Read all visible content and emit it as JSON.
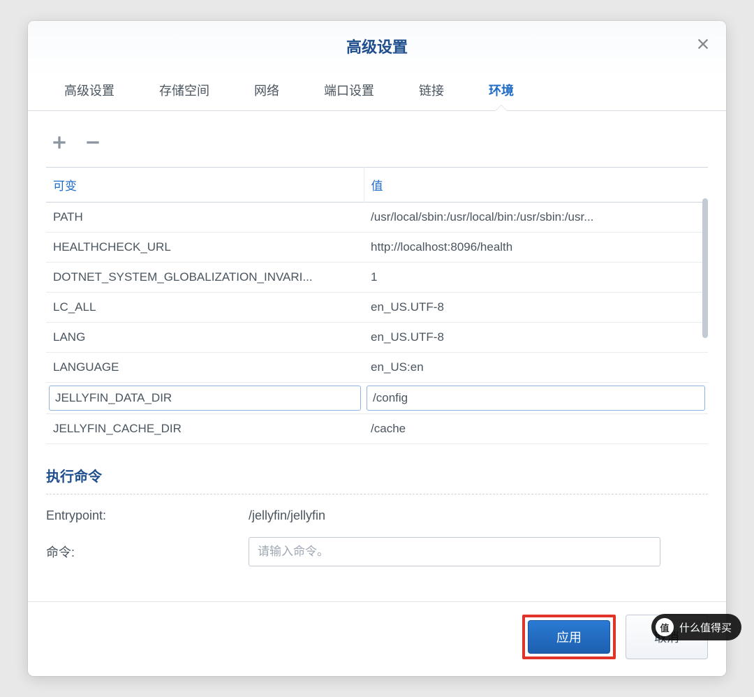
{
  "dialog": {
    "title": "高级设置"
  },
  "tabs": [
    {
      "label": "高级设置",
      "active": false
    },
    {
      "label": "存储空间",
      "active": false
    },
    {
      "label": "网络",
      "active": false
    },
    {
      "label": "端口设置",
      "active": false
    },
    {
      "label": "链接",
      "active": false
    },
    {
      "label": "环境",
      "active": true
    }
  ],
  "env_table": {
    "headers": {
      "key": "可变",
      "value": "值"
    },
    "rows": [
      {
        "key": "PATH",
        "value": "/usr/local/sbin:/usr/local/bin:/usr/sbin:/usr...",
        "selected": false
      },
      {
        "key": "HEALTHCHECK_URL",
        "value": "http://localhost:8096/health",
        "selected": false
      },
      {
        "key": "DOTNET_SYSTEM_GLOBALIZATION_INVARI...",
        "value": "1",
        "selected": false
      },
      {
        "key": "LC_ALL",
        "value": "en_US.UTF-8",
        "selected": false
      },
      {
        "key": "LANG",
        "value": "en_US.UTF-8",
        "selected": false
      },
      {
        "key": "LANGUAGE",
        "value": "en_US:en",
        "selected": false
      },
      {
        "key": "JELLYFIN_DATA_DIR",
        "value": "/config",
        "selected": true
      },
      {
        "key": "JELLYFIN_CACHE_DIR",
        "value": "/cache",
        "selected": false
      }
    ]
  },
  "exec": {
    "section_title": "执行命令",
    "entrypoint_label": "Entrypoint:",
    "entrypoint_value": "/jellyfin/jellyfin",
    "command_label": "命令:",
    "command_placeholder": "请输入命令。",
    "command_value": ""
  },
  "buttons": {
    "apply": "应用",
    "cancel": "取消"
  },
  "watermark": {
    "icon": "值",
    "text": "什么值得买"
  }
}
